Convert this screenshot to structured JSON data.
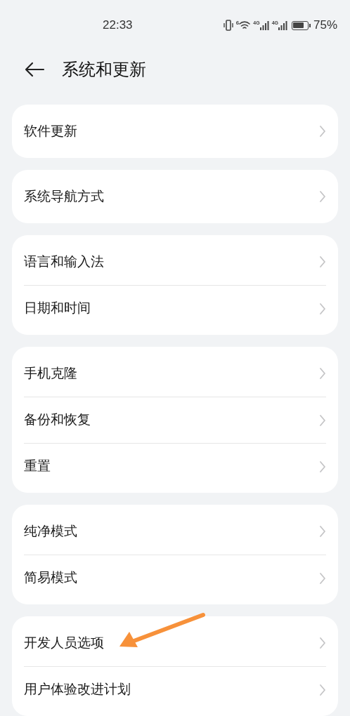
{
  "status_bar": {
    "time": "22:33",
    "wifi_label": "6",
    "signals": [
      {
        "label": "4G"
      },
      {
        "label": "4G"
      }
    ],
    "battery": {
      "text": "75%"
    }
  },
  "header": {
    "title": "系统和更新"
  },
  "groups": [
    {
      "items": [
        {
          "label": "软件更新"
        }
      ]
    },
    {
      "items": [
        {
          "label": "系统导航方式"
        }
      ]
    },
    {
      "items": [
        {
          "label": "语言和输入法"
        },
        {
          "label": "日期和时间"
        }
      ]
    },
    {
      "items": [
        {
          "label": "手机克隆"
        },
        {
          "label": "备份和恢复"
        },
        {
          "label": "重置"
        }
      ]
    },
    {
      "items": [
        {
          "label": "纯净模式"
        },
        {
          "label": "简易模式"
        }
      ]
    },
    {
      "items": [
        {
          "label": "开发人员选项"
        },
        {
          "label": "用户体验改进计划"
        }
      ]
    }
  ]
}
